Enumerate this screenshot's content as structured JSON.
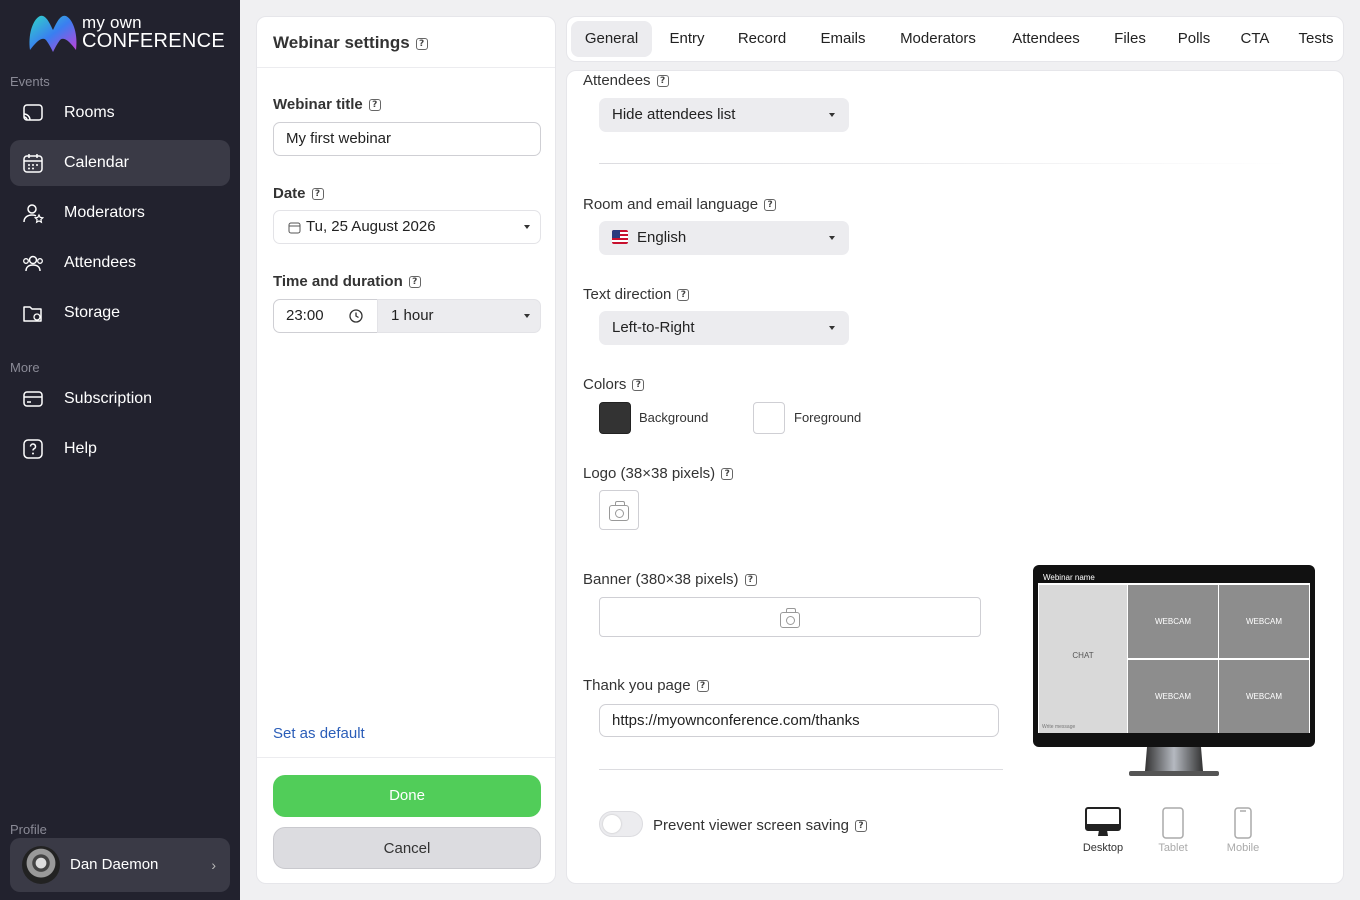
{
  "app": {
    "logo_line1": "my own",
    "logo_line2": "CONFERENCE"
  },
  "sidebar": {
    "section_events": "Events",
    "section_more": "More",
    "section_profile": "Profile",
    "items": [
      {
        "label": "Rooms",
        "icon": "cast-icon"
      },
      {
        "label": "Calendar",
        "icon": "calendar-icon",
        "active": true
      },
      {
        "label": "Moderators",
        "icon": "user-star-icon"
      },
      {
        "label": "Attendees",
        "icon": "users-icon"
      },
      {
        "label": "Storage",
        "icon": "folder-icon"
      },
      {
        "label": "Subscription",
        "icon": "card-icon"
      },
      {
        "label": "Help",
        "icon": "help-icon"
      }
    ],
    "profile": {
      "name": "Dan Daemon"
    }
  },
  "settings": {
    "title": "Webinar settings",
    "webinar_title_label": "Webinar title",
    "webinar_title_value": "My first webinar",
    "date_label": "Date",
    "date_value": "Tu, 25 August 2026",
    "time_label": "Time and duration",
    "time_value": "23:00",
    "duration_value": "1 hour",
    "set_default": "Set as default",
    "done": "Done",
    "cancel": "Cancel"
  },
  "tabs": [
    "General",
    "Entry",
    "Record",
    "Emails",
    "Moderators",
    "Attendees",
    "Files",
    "Polls",
    "CTA",
    "Tests"
  ],
  "general": {
    "attendees_label": "Attendees",
    "attendees_value": "Hide attendees list",
    "language_label": "Room and email language",
    "language_value": "English",
    "direction_label": "Text direction",
    "direction_value": "Left-to-Right",
    "colors_label": "Colors",
    "background_label": "Background",
    "background_color": "#333333",
    "foreground_label": "Foreground",
    "foreground_color": "#ffffff",
    "logo_label": "Logo (38×38 pixels)",
    "banner_label": "Banner (380×38 pixels)",
    "thankyou_label": "Thank you page",
    "thankyou_value": "https://myownconference.com/thanks",
    "prevent_label": "Prevent viewer screen saving",
    "prevent_enabled": false
  },
  "preview": {
    "webinar_name": "Webinar name",
    "chat": "CHAT",
    "write_message": "Write message",
    "webcam": "WEBCAM",
    "devices": [
      "Desktop",
      "Tablet",
      "Mobile"
    ]
  },
  "colors": {
    "accent_green": "#51cd59",
    "sidebar_bg": "#22222e",
    "link_blue": "#2a5db8"
  }
}
